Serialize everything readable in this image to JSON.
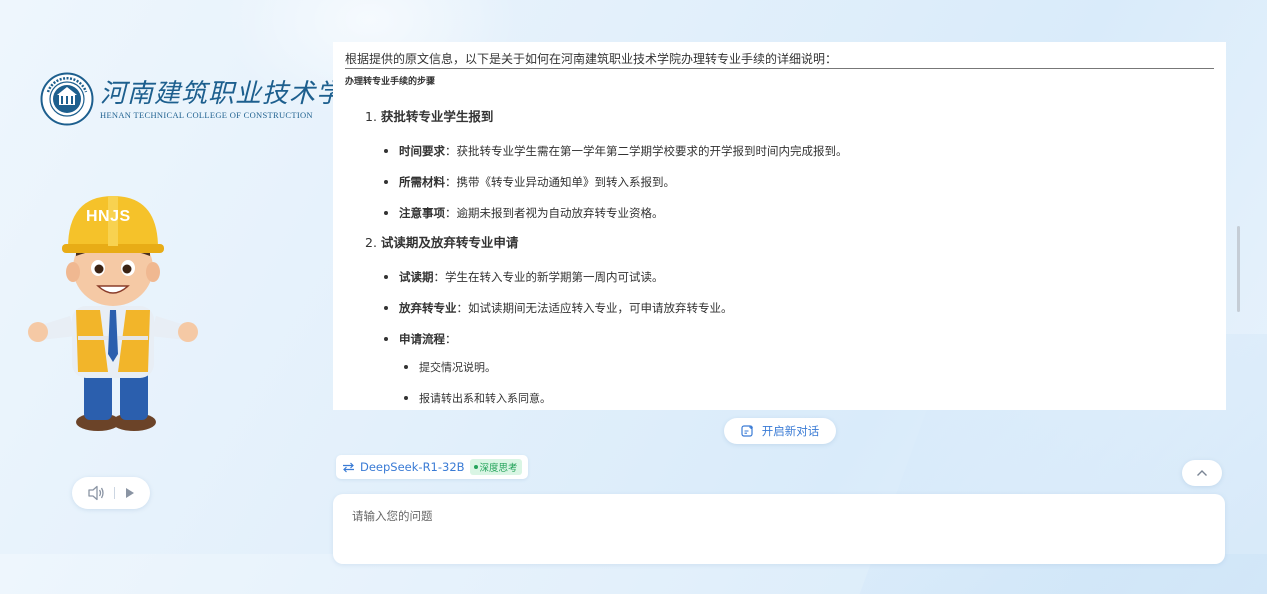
{
  "brand": {
    "name_cn": "河南建筑职业技术学院",
    "name_en": "HENAN TECHNICAL COLLEGE OF CONSTRUCTION",
    "seal_text": "河南建筑职业技术学院",
    "color": "#1d5f8e"
  },
  "mascot": {
    "helmet_text": "HNJS",
    "helmet_color": "#f5c22a"
  },
  "audio": {
    "speaker_icon": "speaker-icon",
    "play_icon": "play-icon"
  },
  "answer": {
    "intro": "根据提供的原文信息，以下是关于如何在河南建筑职业技术学院办理转专业手续的详细说明：",
    "heading": "办理转专业手续的步骤",
    "steps": [
      {
        "num": "1.",
        "title": "获批转专业学生报到",
        "bullets": [
          {
            "label": "时间要求",
            "text": "：获批转专业学生需在第一学年第二学期学校要求的开学报到时间内完成报到。"
          },
          {
            "label": "所需材料",
            "text": "：携带《转专业异动通知单》到转入系报到。"
          },
          {
            "label": "注意事项",
            "text": "：逾期未报到者视为自动放弃转专业资格。"
          }
        ]
      },
      {
        "num": "2.",
        "title": "试读期及放弃转专业申请",
        "bullets": [
          {
            "label": "试读期",
            "text": "：学生在转入专业的新学期第一周内可试读。"
          },
          {
            "label": "放弃转专业",
            "text": "：如试读期间无法适应转入专业，可申请放弃转专业。"
          },
          {
            "label": "申请流程",
            "text": "："
          }
        ],
        "subbullets": [
          "提交情况说明。",
          "报请转出系和转入系同意。"
        ]
      }
    ]
  },
  "new_chat": {
    "label": "开启新对话"
  },
  "model": {
    "name": "DeepSeek-R1-32B",
    "badge": "深度思考",
    "color": "#3a7bd5",
    "badge_color": "#24a35a"
  },
  "input": {
    "placeholder": "请输入您的问题",
    "value": ""
  }
}
